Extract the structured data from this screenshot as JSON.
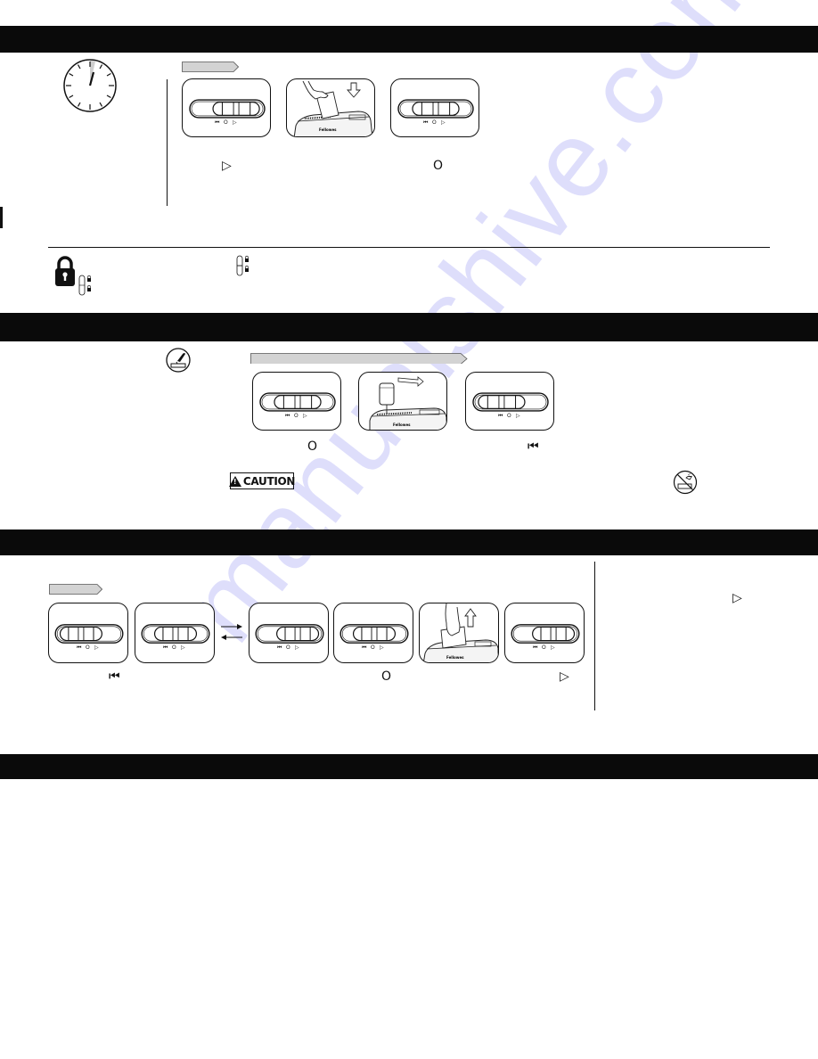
{
  "document": {
    "type": "product-manual-page",
    "section_bars": [
      {
        "id": "section-1",
        "title": ""
      },
      {
        "id": "section-2",
        "title": ""
      },
      {
        "id": "section-3",
        "title": ""
      },
      {
        "id": "section-4",
        "title": ""
      }
    ]
  },
  "switch": {
    "labels": [
      "⏮",
      "O",
      "▷"
    ],
    "positions": {
      "reverse": "⏮",
      "off": "O",
      "auto_on": "▷"
    }
  },
  "section1": {
    "clock_icon": "clock-icon",
    "steps": [
      {
        "panel": "switch",
        "state": "auto_on",
        "caption": "▷"
      },
      {
        "panel": "illustration",
        "illustration": "hand-inserting-paper",
        "caption": ""
      },
      {
        "panel": "switch",
        "state": "off",
        "caption": "O"
      }
    ]
  },
  "lock_section": {
    "lock_icon": "padlock-icon",
    "lock_switch_icons": [
      "safety-lock-switch-icon",
      "safety-lock-switch-icon"
    ]
  },
  "section2": {
    "oil_icon": "oil-shredder-icon",
    "steps": [
      {
        "panel": "switch",
        "state": "off",
        "caption": "O"
      },
      {
        "panel": "illustration",
        "illustration": "oil-bottle-over-slot",
        "caption": ""
      },
      {
        "panel": "switch",
        "state": "reverse",
        "caption": "⏮"
      }
    ],
    "caution_label": "CAUTION",
    "no_aerosol_icon": "no-aerosol-icon"
  },
  "section3": {
    "steps": [
      {
        "panel": "switch",
        "state": "reverse",
        "caption": "⏮"
      },
      {
        "panel": "switch",
        "state": "off",
        "caption": ""
      },
      {
        "panel": "switch",
        "state": "auto_on",
        "caption": ""
      },
      {
        "panel": "switch",
        "state": "off",
        "caption": "O"
      },
      {
        "panel": "illustration",
        "illustration": "hand-removing-paper",
        "caption": ""
      },
      {
        "panel": "switch",
        "state": "auto_on",
        "caption": "▷"
      }
    ],
    "repeat_arrows": [
      "→",
      "←"
    ],
    "sidebar_glyph": "▷"
  },
  "watermark": "manualshive.com"
}
